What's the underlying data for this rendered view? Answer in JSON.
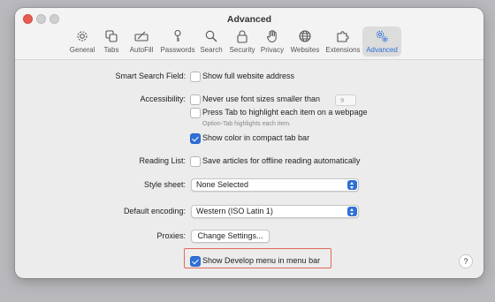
{
  "window": {
    "title": "Advanced"
  },
  "tabs": [
    {
      "label": "General",
      "icon": "gear-icon"
    },
    {
      "label": "Tabs",
      "icon": "tabs-icon"
    },
    {
      "label": "AutoFill",
      "icon": "autofill-icon"
    },
    {
      "label": "Passwords",
      "icon": "key-icon"
    },
    {
      "label": "Search",
      "icon": "search-icon"
    },
    {
      "label": "Security",
      "icon": "lock-icon"
    },
    {
      "label": "Privacy",
      "icon": "hand-icon"
    },
    {
      "label": "Websites",
      "icon": "globe-icon"
    },
    {
      "label": "Extensions",
      "icon": "puzzle-icon"
    },
    {
      "label": "Advanced",
      "icon": "gears-icon",
      "active": true
    }
  ],
  "smart_search": {
    "label": "Smart Search Field:",
    "option": "Show full website address",
    "checked": false
  },
  "accessibility": {
    "label": "Accessibility:",
    "font_option": "Never use font sizes smaller than",
    "font_size": "9",
    "tab_option": "Press Tab to highlight each item on a webpage",
    "tab_hint": "Option-Tab highlights each item.",
    "color_option": "Show color in compact tab bar",
    "color_checked": true
  },
  "reading_list": {
    "label": "Reading List:",
    "option": "Save articles for offline reading automatically"
  },
  "style_sheet": {
    "label": "Style sheet:",
    "value": "None Selected"
  },
  "encoding": {
    "label": "Default encoding:",
    "value": "Western (ISO Latin 1)"
  },
  "proxies": {
    "label": "Proxies:",
    "button": "Change Settings..."
  },
  "develop": {
    "option": "Show Develop menu in menu bar",
    "checked": true
  },
  "help": {
    "label": "?"
  },
  "colors": {
    "accent": "#2f6fd6",
    "highlight": "#e06a5a",
    "window": "#ececec"
  }
}
